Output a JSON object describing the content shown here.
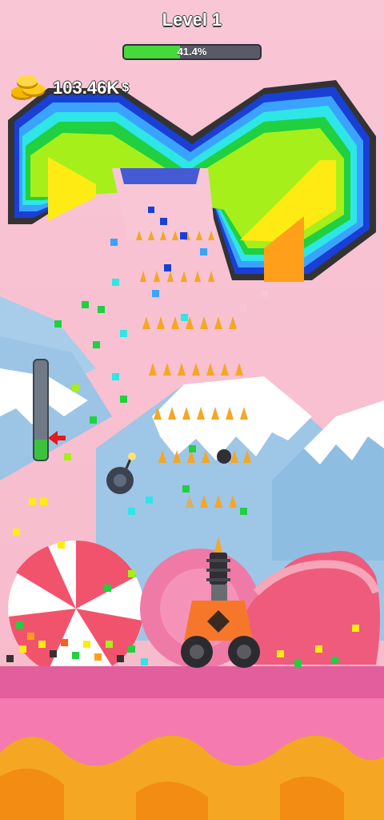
{
  "hud": {
    "level_label": "Level 1",
    "progress_label": "41.4%",
    "progress_fraction": 0.414,
    "money_value": "103.46K",
    "money_unit": "$"
  },
  "fuel_gauge": {
    "fill_fraction": 0.2
  },
  "icons": [
    "coin-stack-icon",
    "bomb-icon"
  ],
  "colors": {
    "sky": "#f7c6d4",
    "mountain": "#9fc6e6",
    "snow": "#ffffff",
    "ground": "#f47ab0",
    "ground_dark": "#e25e9c",
    "caramel": "#f5a623",
    "rainbow": [
      "#333333",
      "#1a3fd6",
      "#3aa3ff",
      "#2ee6e6",
      "#20d040",
      "#a6ef1a",
      "#ffeb14",
      "#ff9f1a",
      "#ff5a1a"
    ],
    "progress_fill": "#45d93c"
  }
}
